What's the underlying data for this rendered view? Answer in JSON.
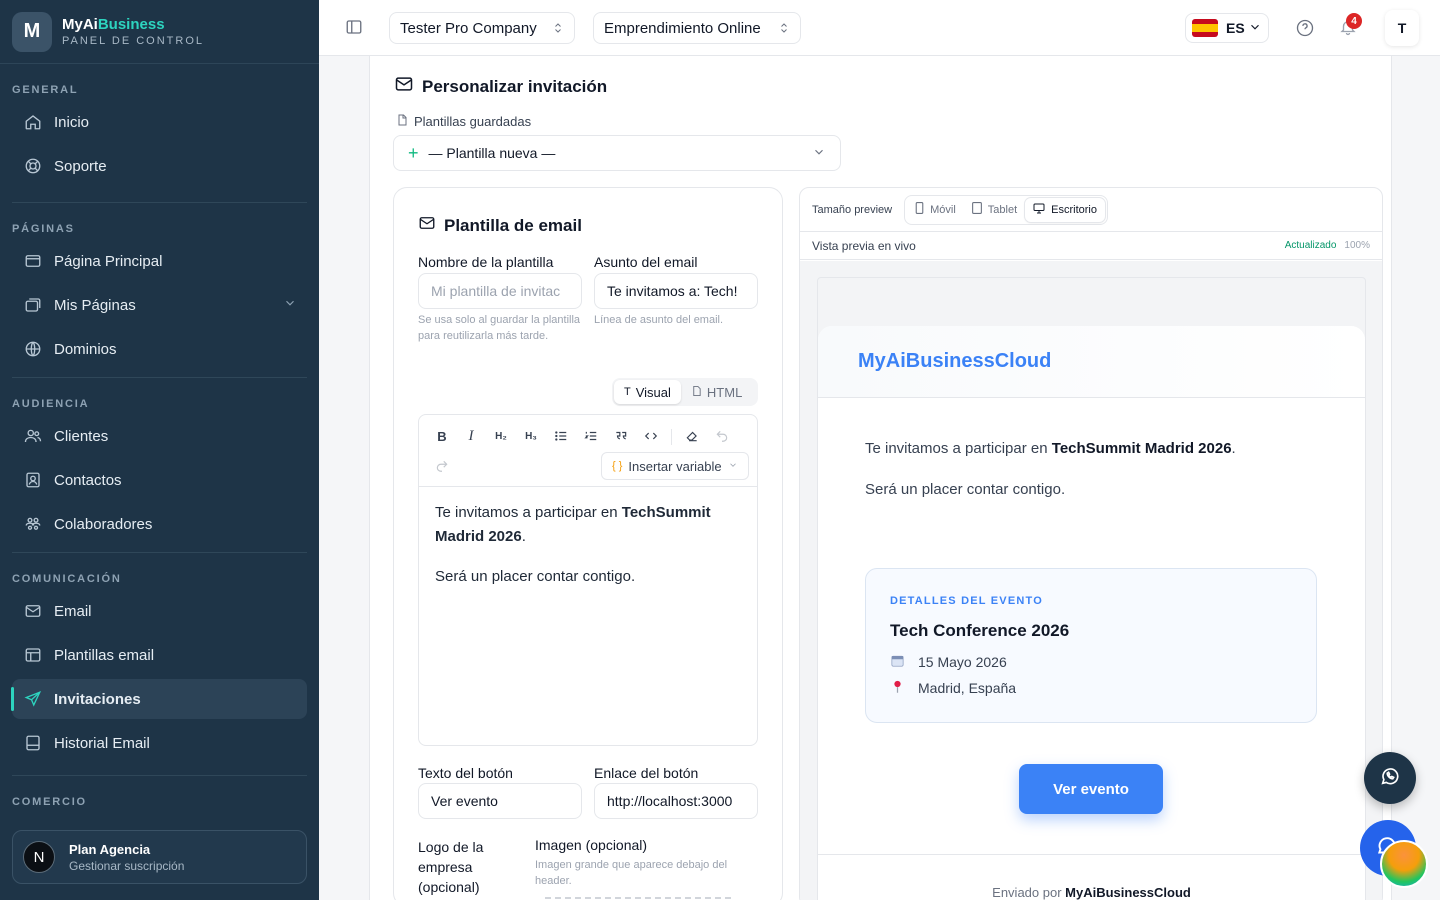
{
  "brand": {
    "logo": "M",
    "name_a": "MyAi",
    "name_b": "Business",
    "subtitle": "PANEL DE CONTROL"
  },
  "sidebar": {
    "sections": [
      {
        "label": "GENERAL",
        "items": [
          {
            "label": "Inicio",
            "icon": "home-icon"
          },
          {
            "label": "Soporte",
            "icon": "lifebuoy-icon"
          }
        ]
      },
      {
        "label": "PÁGINAS",
        "items": [
          {
            "label": "Página Principal",
            "icon": "window-icon"
          },
          {
            "label": "Mis Páginas",
            "icon": "pages-icon"
          },
          {
            "label": "Dominios",
            "icon": "globe-icon"
          }
        ]
      },
      {
        "label": "AUDIENCIA",
        "items": [
          {
            "label": "Clientes",
            "icon": "users-icon"
          },
          {
            "label": "Contactos",
            "icon": "contact-icon"
          },
          {
            "label": "Colaboradores",
            "icon": "team-icon"
          }
        ]
      },
      {
        "label": "COMUNICACIÓN",
        "items": [
          {
            "label": "Email",
            "icon": "mail-icon"
          },
          {
            "label": "Plantillas email",
            "icon": "layout-icon"
          },
          {
            "label": "Invitaciones",
            "icon": "send-icon"
          },
          {
            "label": "Historial Email",
            "icon": "inbox-icon"
          }
        ]
      },
      {
        "label": "COMERCIO"
      }
    ],
    "plan": {
      "avatar": "N",
      "title": "Plan Agencia",
      "subtitle": "Gestionar suscripción"
    }
  },
  "topbar": {
    "company": "Tester Pro Company",
    "project": "Emprendimiento Online",
    "language": "ES",
    "notifications": "4",
    "user_initial": "T"
  },
  "page": {
    "title": "Personalizar invitación",
    "saved_label": "Plantillas guardadas",
    "saved_value": "— Plantilla nueva —"
  },
  "editor_card": {
    "title": "Plantilla de email",
    "name_label": "Nombre de la plantilla",
    "name_placeholder": "Mi plantilla de invitac",
    "name_help": "Se usa solo al guardar la plantilla para reutilizarla más tarde.",
    "subject_label": "Asunto del email",
    "subject_value": "Te invitamos a: Tech!",
    "subject_help": "Línea de asunto del email.",
    "mode_visual": "Visual",
    "mode_html": "HTML",
    "toolbar": {
      "bold": "B",
      "italic": "I",
      "h2": "H₂",
      "h3": "H₃",
      "insert_variable": "Insertar variable"
    },
    "body_p1_a": "Te invitamos a participar en ",
    "body_p1_b": "TechSummit Madrid 2026",
    "body_p1_c": ".",
    "body_p2": "Será un placer contar contigo.",
    "button_text_label": "Texto del botón",
    "button_text_value": "Ver evento",
    "button_link_label": "Enlace del botón",
    "button_link_value": "http://localhost:3000",
    "logo_label": "Logo de la empresa (opcional)",
    "image_label": "Imagen (opcional)",
    "image_help": "Imagen grande que aparece debajo del header."
  },
  "preview": {
    "size_label": "Tamaño preview",
    "devices": [
      "Móvil",
      "Tablet",
      "Escritorio"
    ],
    "live_label": "Vista previa en vivo",
    "status": "Actualizado",
    "zoom": "100%",
    "email": {
      "brand": "MyAiBusinessCloud",
      "p1_a": "Te invitamos a participar en ",
      "p1_b": "TechSummit Madrid 2026",
      "p1_c": ".",
      "p2": "Será un placer contar contigo.",
      "details_label": "DETALLES DEL EVENTO",
      "event_title": "Tech Conference 2026",
      "event_date": "15 Mayo 2026",
      "event_place": "Madrid, España",
      "cta": "Ver evento",
      "footer_a": "Enviado por ",
      "footer_b": "MyAiBusinessCloud"
    }
  },
  "colors": {
    "sidebar_bg": "#1e3447",
    "accent": "#2dd4bf",
    "primary": "#3b82f6",
    "badge": "#dc2626"
  }
}
